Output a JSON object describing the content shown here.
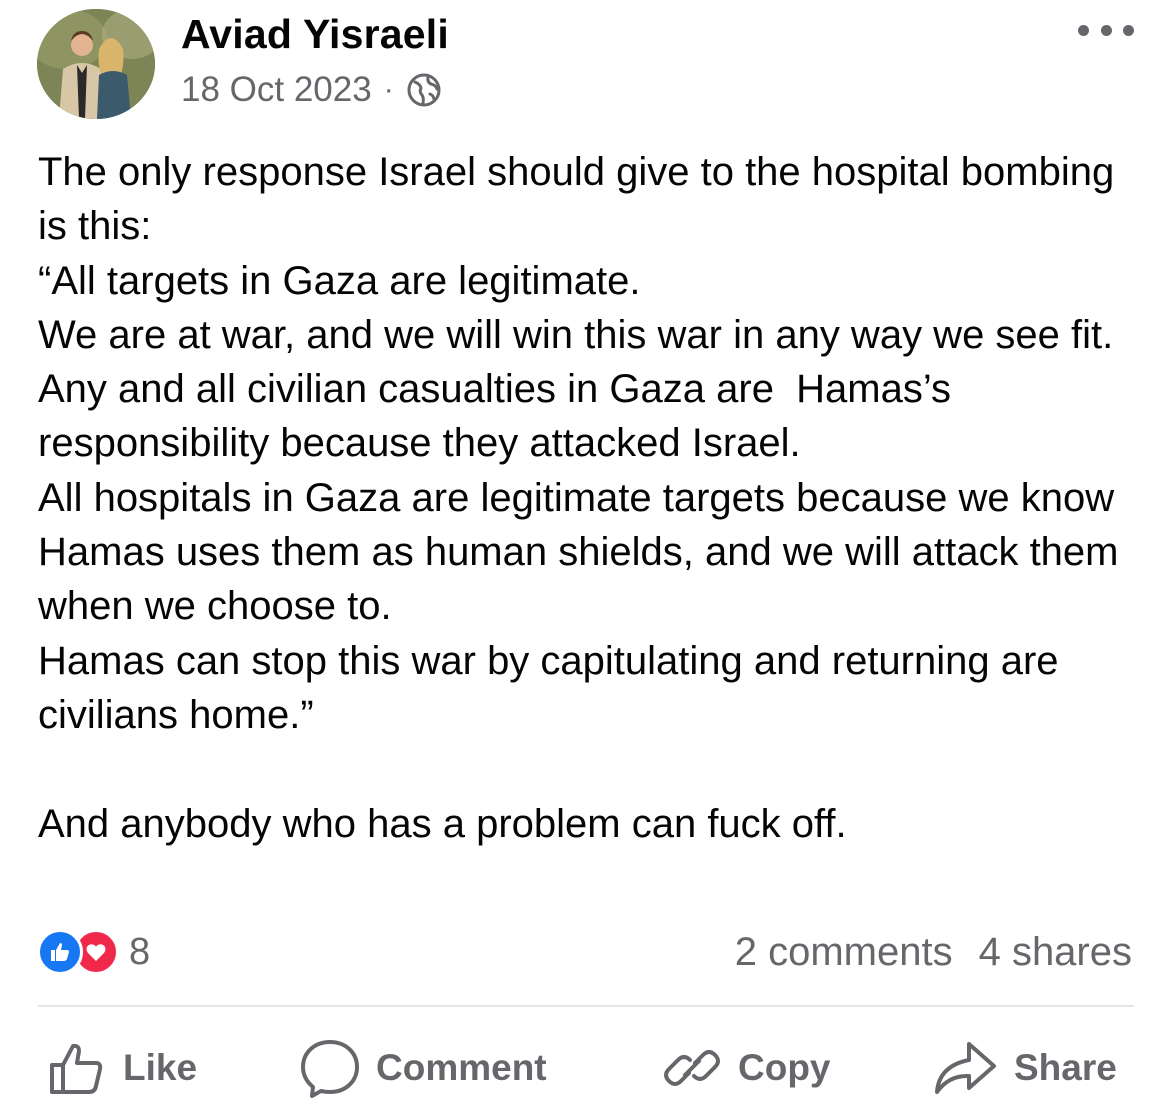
{
  "post": {
    "author": "Aviad Yisraeli",
    "date": "18 Oct 2023",
    "separator": "·",
    "audience_icon": "globe-icon",
    "body": "The only response Israel should give to the hospital bombing is this:\n“All targets in Gaza are legitimate.\nWe are at war, and we will win this war in any way we see fit.\nAny and all civilian casualties in Gaza are  Hamas’s responsibility because they attacked Israel.\nAll hospitals in Gaza are legitimate targets because we know Hamas uses them as human shields, and we will attack them when we choose to.\nHamas can stop this war by capitulating and returning are civilians home.”\n\nAnd anybody who has a problem can fuck off.",
    "reaction_count": "8",
    "comments": "2 comments",
    "shares": "4 shares"
  },
  "actions": {
    "like": "Like",
    "comment": "Comment",
    "copy": "Copy",
    "share": "Share"
  },
  "colors": {
    "text": "#050505",
    "secondary": "#65676b",
    "like_blue": "#1877f2",
    "love_red": "#f02849",
    "divider": "#e4e6eb"
  }
}
